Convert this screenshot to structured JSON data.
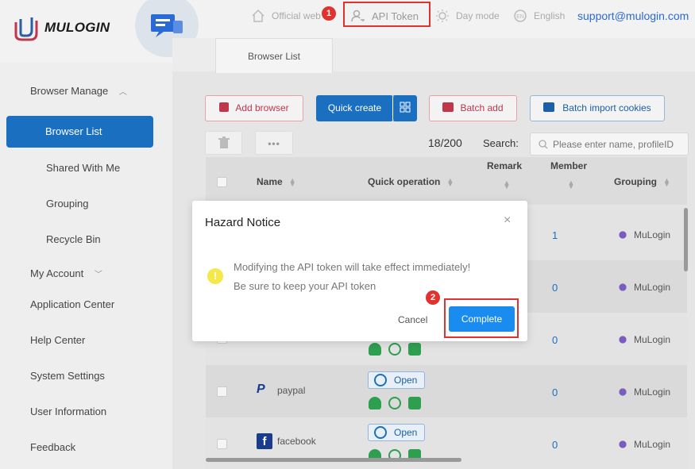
{
  "app": {
    "logo_text": "MULOGIN"
  },
  "topnav": {
    "official": "Official web",
    "api_token": "API Token",
    "day_mode": "Day mode",
    "language": "English",
    "support": "support@mulogin.com"
  },
  "annotations": {
    "step1": "1",
    "step2": "2",
    "highlight_color": "#e0322f"
  },
  "sidebar": {
    "browser_manage": "Browser Manage",
    "browser_list": "Browser List",
    "shared_with_me": "Shared With Me",
    "grouping": "Grouping",
    "recycle_bin": "Recycle Bin",
    "my_account": "My Account",
    "application_center": "Application Center",
    "help_center": "Help Center",
    "system_settings": "System Settings",
    "user_information": "User Information",
    "feedback": "Feedback"
  },
  "tabs": [
    {
      "label": "Browser List"
    }
  ],
  "toolbar": {
    "add_browser": "Add browser",
    "quick_create": "Quick create",
    "batch_add": "Batch add",
    "batch_import_cookies": "Batch import cookies",
    "count": "18/200",
    "search_label": "Search:",
    "search_placeholder": "Please enter name, profileID"
  },
  "table": {
    "headers": {
      "name": "Name",
      "quick_operation": "Quick operation",
      "remark": "Remark",
      "member": "Member",
      "grouping": "Grouping"
    },
    "rows": [
      {
        "name": "",
        "member": "1",
        "grouping": "MuLogin",
        "has_open": false
      },
      {
        "name": "",
        "member": "0",
        "grouping": "MuLogin",
        "has_open": false
      },
      {
        "name": "",
        "member": "0",
        "grouping": "MuLogin",
        "has_open": false
      },
      {
        "name": "paypal",
        "member": "0",
        "grouping": "MuLogin",
        "open": "Open"
      },
      {
        "name": "facebook",
        "member": "0",
        "grouping": "MuLogin",
        "open": "Open"
      }
    ]
  },
  "modal": {
    "title": "Hazard Notice",
    "close": "×",
    "message_line1": "Modifying the API token will take effect immediately!",
    "message_line2": "Be sure to keep your API token",
    "cancel": "Cancel",
    "complete": "Complete"
  },
  "colors": {
    "primary": "#1a6fc0",
    "complete_button": "#1a8cf0",
    "warning": "#f5e84a",
    "danger_outline": "#c0364b"
  }
}
